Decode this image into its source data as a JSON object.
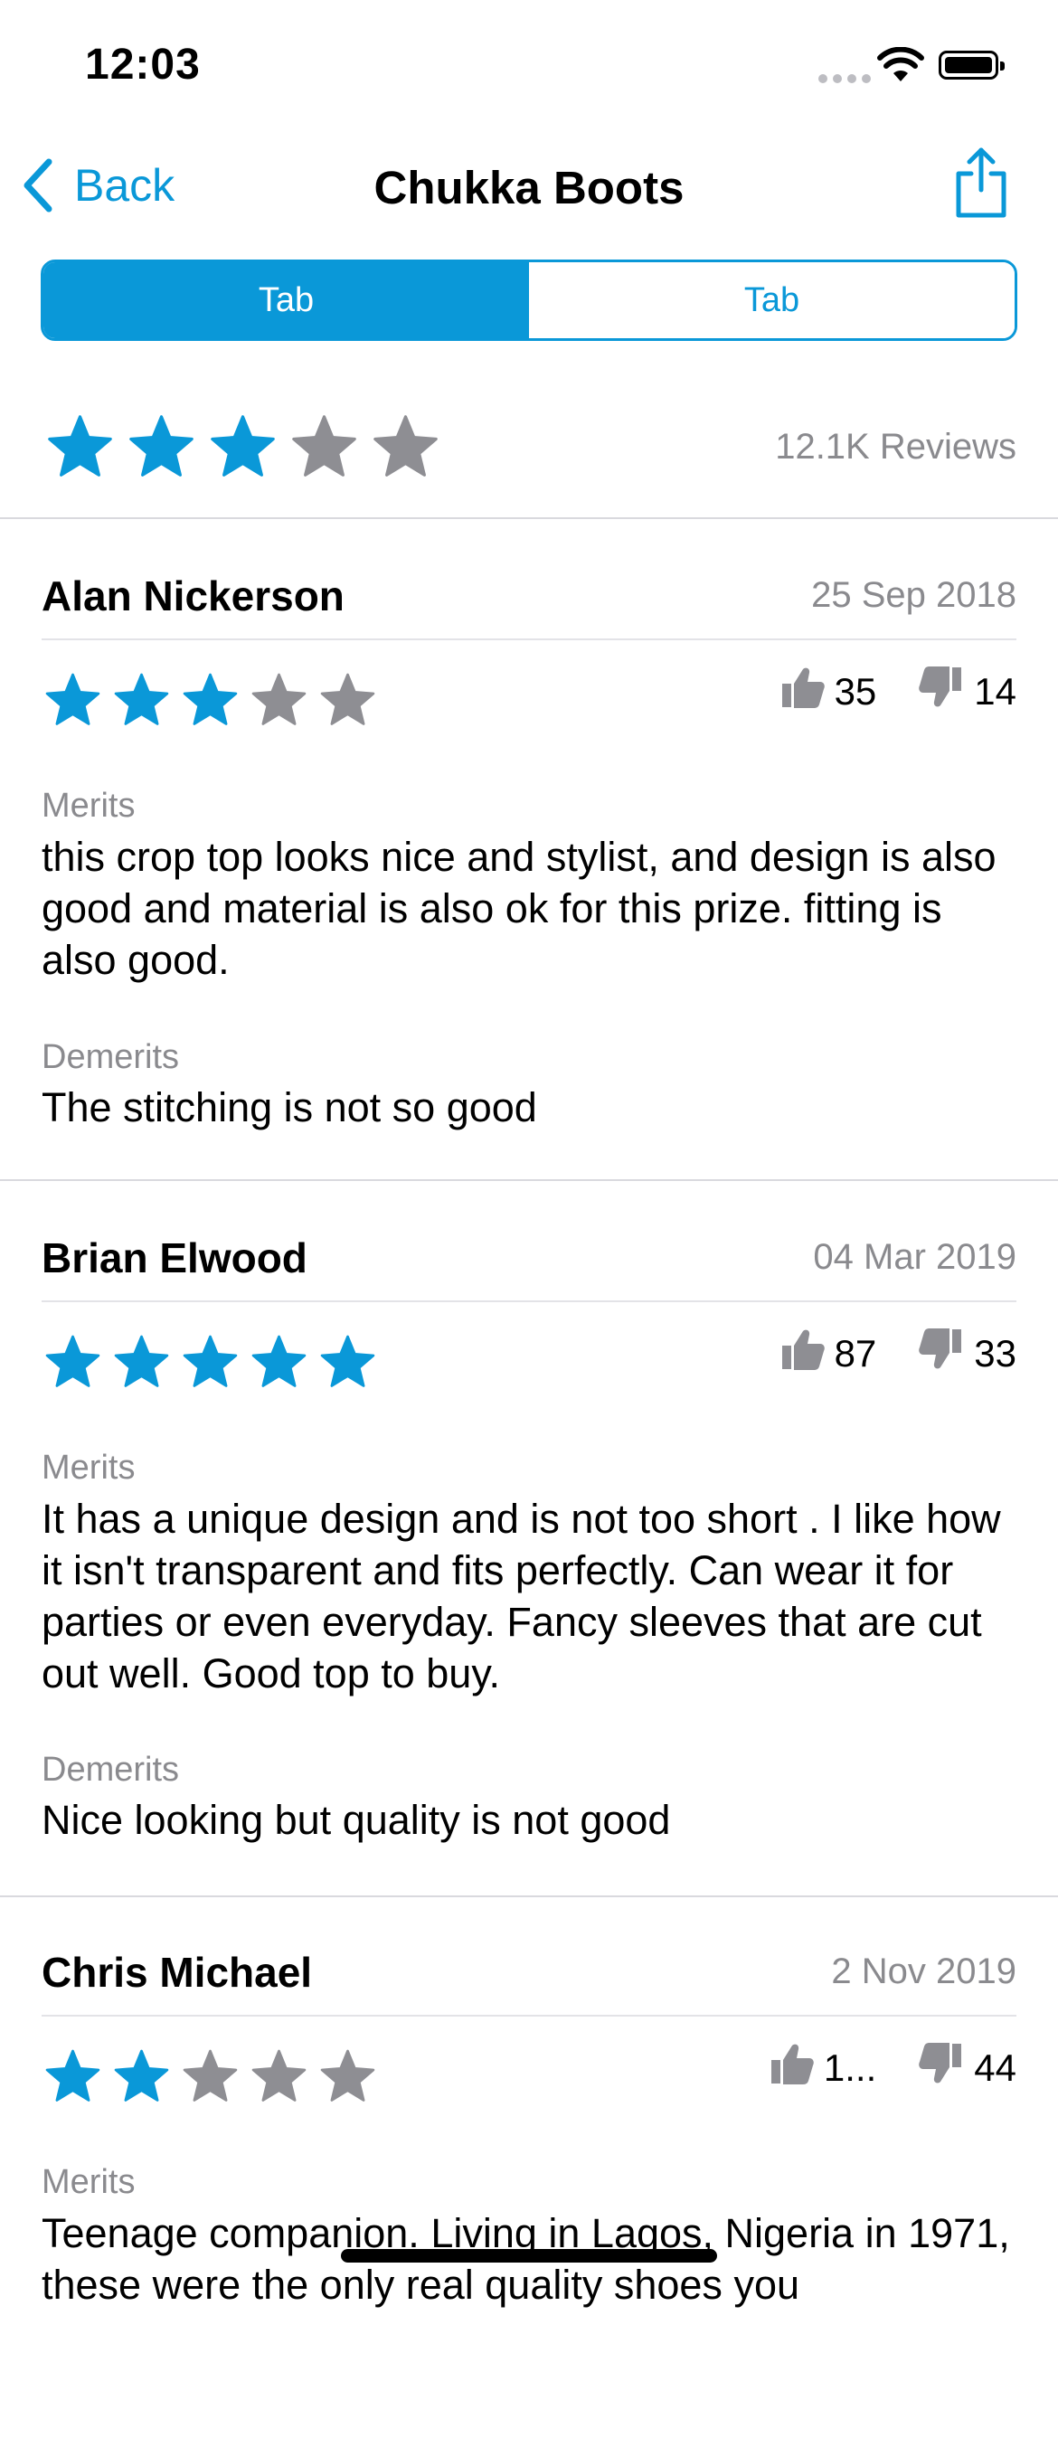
{
  "status_bar": {
    "time": "12:03"
  },
  "nav": {
    "back_label": "Back",
    "title": "Chukka Boots"
  },
  "tabs": [
    {
      "label": "Tab",
      "active": true
    },
    {
      "label": "Tab",
      "active": false
    }
  ],
  "summary": {
    "rating": 3,
    "max_rating": 5,
    "reviews_label": "12.1K Reviews"
  },
  "colors": {
    "accent": "#0a98d8",
    "star_off": "#8e8e93",
    "secondary_text": "#8a8a8e"
  },
  "reviews": [
    {
      "name": "Alan Nickerson",
      "date": "25 Sep 2018",
      "rating": 3,
      "likes": "35",
      "dislikes": "14",
      "merits_label": "Merits",
      "merits": "this crop top looks nice and stylist, and design is also good and material is also ok for this prize. fitting is also good.",
      "demerits_label": "Demerits",
      "demerits": "The stitching is not so good"
    },
    {
      "name": "Brian Elwood",
      "date": "04 Mar 2019",
      "rating": 5,
      "likes": "87",
      "dislikes": "33",
      "merits_label": "Merits",
      "merits": "It has a unique design and is not too short . I like how it isn't transparent and fits perfectly. Can wear it for parties or even everyday. Fancy sleeves that are cut out well. Good top to buy.",
      "demerits_label": "Demerits",
      "demerits": "Nice looking but quality is not good"
    },
    {
      "name": "Chris Michael",
      "date": "2 Nov 2019",
      "rating": 2,
      "likes": "1...",
      "dislikes": "44",
      "merits_label": "Merits",
      "merits": "Teenage companion. Living in Lagos, Nigeria in 1971, these were the only real quality shoes you"
    }
  ],
  "icons": {
    "back": "chevron-left-icon",
    "share": "share-icon",
    "star": "star-icon",
    "like": "thumbs-up-icon",
    "dislike": "thumbs-down-icon"
  }
}
